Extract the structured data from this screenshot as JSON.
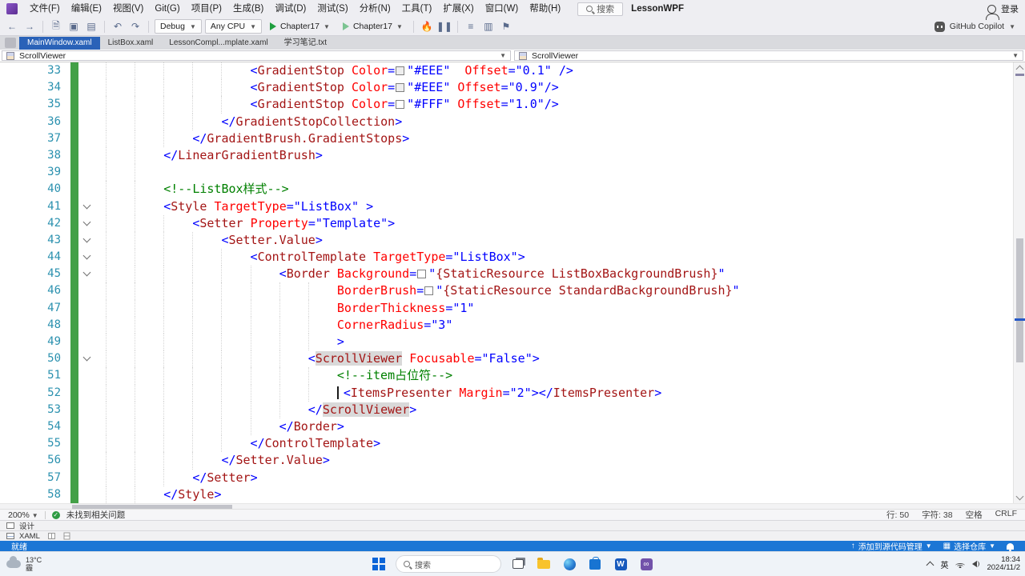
{
  "colors": {
    "xml_name": "#A31515",
    "xml_attr": "#FF0000",
    "xml_value": "#0000FF",
    "xml_delim": "#0000FF",
    "xml_comment": "#008000",
    "highlight_bg": "#d9d9d9",
    "linenum": "#2B91AF",
    "change_green": "#43a047",
    "tab_active": "#2a62b8",
    "status_blue": "#1c76d5"
  },
  "window": {
    "solution_name": "LessonWPF"
  },
  "menu": {
    "items": [
      "文件(F)",
      "编辑(E)",
      "视图(V)",
      "Git(G)",
      "项目(P)",
      "生成(B)",
      "调试(D)",
      "测试(S)",
      "分析(N)",
      "工具(T)",
      "扩展(X)",
      "窗口(W)",
      "帮助(H)"
    ],
    "search_label": "搜索",
    "signin_label": "登录"
  },
  "toolbar": {
    "config": "Debug",
    "platform": "Any CPU",
    "run_primary": "Chapter17",
    "run_secondary": "Chapter17",
    "copilot_label": "GitHub Copilot"
  },
  "tabs": [
    {
      "label": "MainWindow.xaml",
      "active": true
    },
    {
      "label": "ListBox.xaml",
      "active": false
    },
    {
      "label": "LessonCompl...mplate.xaml",
      "active": false
    },
    {
      "label": "学习笔记.txt",
      "active": false
    }
  ],
  "navbar": {
    "left_selector": "ScrollViewer",
    "right_selector": "ScrollViewer"
  },
  "editor": {
    "lines": [
      {
        "n": 33,
        "ind": 5,
        "fold": false,
        "segs": [
          [
            "d",
            "<"
          ],
          [
            "e",
            "GradientStop"
          ],
          [
            "t",
            " "
          ],
          [
            "a",
            "Color"
          ],
          [
            "d",
            "="
          ],
          [
            "w",
            "#EEEEEE"
          ],
          [
            "v",
            "\"#EEE\""
          ],
          [
            "t",
            "  "
          ],
          [
            "a",
            "Offset"
          ],
          [
            "d",
            "="
          ],
          [
            "v",
            "\"0.1\""
          ],
          [
            "t",
            " "
          ],
          [
            "d",
            "/>"
          ]
        ]
      },
      {
        "n": 34,
        "ind": 5,
        "fold": false,
        "segs": [
          [
            "d",
            "<"
          ],
          [
            "e",
            "GradientStop"
          ],
          [
            "t",
            " "
          ],
          [
            "a",
            "Color"
          ],
          [
            "d",
            "="
          ],
          [
            "w",
            "#EEEEEE"
          ],
          [
            "v",
            "\"#EEE\""
          ],
          [
            "t",
            " "
          ],
          [
            "a",
            "Offset"
          ],
          [
            "d",
            "="
          ],
          [
            "v",
            "\"0.9\""
          ],
          [
            "d",
            "/>"
          ]
        ]
      },
      {
        "n": 35,
        "ind": 5,
        "fold": false,
        "segs": [
          [
            "d",
            "<"
          ],
          [
            "e",
            "GradientStop"
          ],
          [
            "t",
            " "
          ],
          [
            "a",
            "Color"
          ],
          [
            "d",
            "="
          ],
          [
            "w",
            "#FFFFFF"
          ],
          [
            "v",
            "\"#FFF\""
          ],
          [
            "t",
            " "
          ],
          [
            "a",
            "Offset"
          ],
          [
            "d",
            "="
          ],
          [
            "v",
            "\"1.0\""
          ],
          [
            "d",
            "/>"
          ]
        ]
      },
      {
        "n": 36,
        "ind": 4,
        "fold": false,
        "segs": [
          [
            "d",
            "</"
          ],
          [
            "e",
            "GradientStopCollection"
          ],
          [
            "d",
            ">"
          ]
        ]
      },
      {
        "n": 37,
        "ind": 3,
        "fold": false,
        "segs": [
          [
            "d",
            "</"
          ],
          [
            "e",
            "GradientBrush.GradientStops"
          ],
          [
            "d",
            ">"
          ]
        ]
      },
      {
        "n": 38,
        "ind": 2,
        "fold": false,
        "segs": [
          [
            "d",
            "</"
          ],
          [
            "e",
            "LinearGradientBrush"
          ],
          [
            "d",
            ">"
          ]
        ]
      },
      {
        "n": 39,
        "ind": 2,
        "fold": false,
        "segs": []
      },
      {
        "n": 40,
        "ind": 2,
        "fold": false,
        "segs": [
          [
            "c",
            "<!--ListBox样式-->"
          ]
        ]
      },
      {
        "n": 41,
        "ind": 2,
        "fold": true,
        "segs": [
          [
            "d",
            "<"
          ],
          [
            "e",
            "Style"
          ],
          [
            "t",
            " "
          ],
          [
            "a",
            "TargetType"
          ],
          [
            "d",
            "="
          ],
          [
            "v",
            "\"ListBox\""
          ],
          [
            "t",
            " "
          ],
          [
            "d",
            ">"
          ]
        ]
      },
      {
        "n": 42,
        "ind": 3,
        "fold": true,
        "segs": [
          [
            "d",
            "<"
          ],
          [
            "e",
            "Setter"
          ],
          [
            "t",
            " "
          ],
          [
            "a",
            "Property"
          ],
          [
            "d",
            "="
          ],
          [
            "v",
            "\"Template\""
          ],
          [
            "d",
            ">"
          ]
        ]
      },
      {
        "n": 43,
        "ind": 4,
        "fold": true,
        "segs": [
          [
            "d",
            "<"
          ],
          [
            "e",
            "Setter.Value"
          ],
          [
            "d",
            ">"
          ]
        ]
      },
      {
        "n": 44,
        "ind": 5,
        "fold": true,
        "segs": [
          [
            "d",
            "<"
          ],
          [
            "e",
            "ControlTemplate"
          ],
          [
            "t",
            " "
          ],
          [
            "a",
            "TargetType"
          ],
          [
            "d",
            "="
          ],
          [
            "v",
            "\"ListBox\""
          ],
          [
            "d",
            ">"
          ]
        ]
      },
      {
        "n": 45,
        "ind": 6,
        "fold": true,
        "segs": [
          [
            "d",
            "<"
          ],
          [
            "e",
            "Border"
          ],
          [
            "t",
            " "
          ],
          [
            "a",
            "Background"
          ],
          [
            "d",
            "="
          ],
          [
            "w",
            "#FFFFFF"
          ],
          [
            "d",
            "\""
          ],
          [
            "m",
            "{StaticResource ListBoxBackgroundBrush}"
          ],
          [
            "d",
            "\""
          ]
        ]
      },
      {
        "n": 46,
        "ind": 8,
        "fold": false,
        "segs": [
          [
            "a",
            "BorderBrush"
          ],
          [
            "d",
            "="
          ],
          [
            "w",
            "#FFFFFF"
          ],
          [
            "d",
            "\""
          ],
          [
            "m",
            "{StaticResource StandardBackgroundBrush}"
          ],
          [
            "d",
            "\""
          ]
        ]
      },
      {
        "n": 47,
        "ind": 8,
        "fold": false,
        "segs": [
          [
            "a",
            "BorderThickness"
          ],
          [
            "d",
            "="
          ],
          [
            "v",
            "\"1\""
          ]
        ]
      },
      {
        "n": 48,
        "ind": 8,
        "fold": false,
        "segs": [
          [
            "a",
            "CornerRadius"
          ],
          [
            "d",
            "="
          ],
          [
            "v",
            "\"3\""
          ]
        ]
      },
      {
        "n": 49,
        "ind": 8,
        "fold": false,
        "segs": [
          [
            "d",
            ">"
          ]
        ]
      },
      {
        "n": 50,
        "ind": 7,
        "fold": true,
        "segs": [
          [
            "d",
            "<"
          ],
          [
            "h",
            "ScrollViewer"
          ],
          [
            "t",
            " "
          ],
          [
            "a",
            "Focusable"
          ],
          [
            "d",
            "="
          ],
          [
            "v",
            "\"False\""
          ],
          [
            "d",
            ">"
          ]
        ]
      },
      {
        "n": 51,
        "ind": 8,
        "fold": false,
        "segs": [
          [
            "c",
            "<!--item占位符-->"
          ]
        ]
      },
      {
        "n": 52,
        "ind": 8,
        "fold": false,
        "segs": [
          [
            "k",
            ""
          ],
          [
            "d",
            "<"
          ],
          [
            "e",
            "ItemsPresenter"
          ],
          [
            "t",
            " "
          ],
          [
            "a",
            "Margin"
          ],
          [
            "d",
            "="
          ],
          [
            "v",
            "\"2\""
          ],
          [
            "d",
            ">"
          ],
          [
            "d",
            "</"
          ],
          [
            "e",
            "ItemsPresenter"
          ],
          [
            "d",
            ">"
          ]
        ]
      },
      {
        "n": 53,
        "ind": 7,
        "fold": false,
        "segs": [
          [
            "d",
            "</"
          ],
          [
            "h",
            "ScrollViewer"
          ],
          [
            "d",
            ">"
          ]
        ]
      },
      {
        "n": 54,
        "ind": 6,
        "fold": false,
        "segs": [
          [
            "d",
            "</"
          ],
          [
            "e",
            "Border"
          ],
          [
            "d",
            ">"
          ]
        ]
      },
      {
        "n": 55,
        "ind": 5,
        "fold": false,
        "segs": [
          [
            "d",
            "</"
          ],
          [
            "e",
            "ControlTemplate"
          ],
          [
            "d",
            ">"
          ]
        ]
      },
      {
        "n": 56,
        "ind": 4,
        "fold": false,
        "segs": [
          [
            "d",
            "</"
          ],
          [
            "e",
            "Setter.Value"
          ],
          [
            "d",
            ">"
          ]
        ]
      },
      {
        "n": 57,
        "ind": 3,
        "fold": false,
        "segs": [
          [
            "d",
            "</"
          ],
          [
            "e",
            "Setter"
          ],
          [
            "d",
            ">"
          ]
        ]
      },
      {
        "n": 58,
        "ind": 2,
        "fold": false,
        "segs": [
          [
            "d",
            "</"
          ],
          [
            "e",
            "Style"
          ],
          [
            "d",
            ">"
          ]
        ]
      }
    ]
  },
  "editor_footer": {
    "zoom": "200%",
    "health": "未找到相关问题",
    "line": "行: 50",
    "col": "字符: 38",
    "space": "空格",
    "eol": "CRLF"
  },
  "bottom_tabs": {
    "design": "设计",
    "xaml": "XAML"
  },
  "statusbar": {
    "ready": "就绪",
    "add_to_source_control": "添加到源代码管理",
    "select_repo": "选择仓库"
  },
  "taskbar": {
    "temp": "13°C",
    "cond": "霾",
    "search_placeholder": "搜索",
    "ime": "英",
    "time": "18:34",
    "date": "2024/11/2",
    "word_letter": "W",
    "vs_glyph": "∞"
  }
}
